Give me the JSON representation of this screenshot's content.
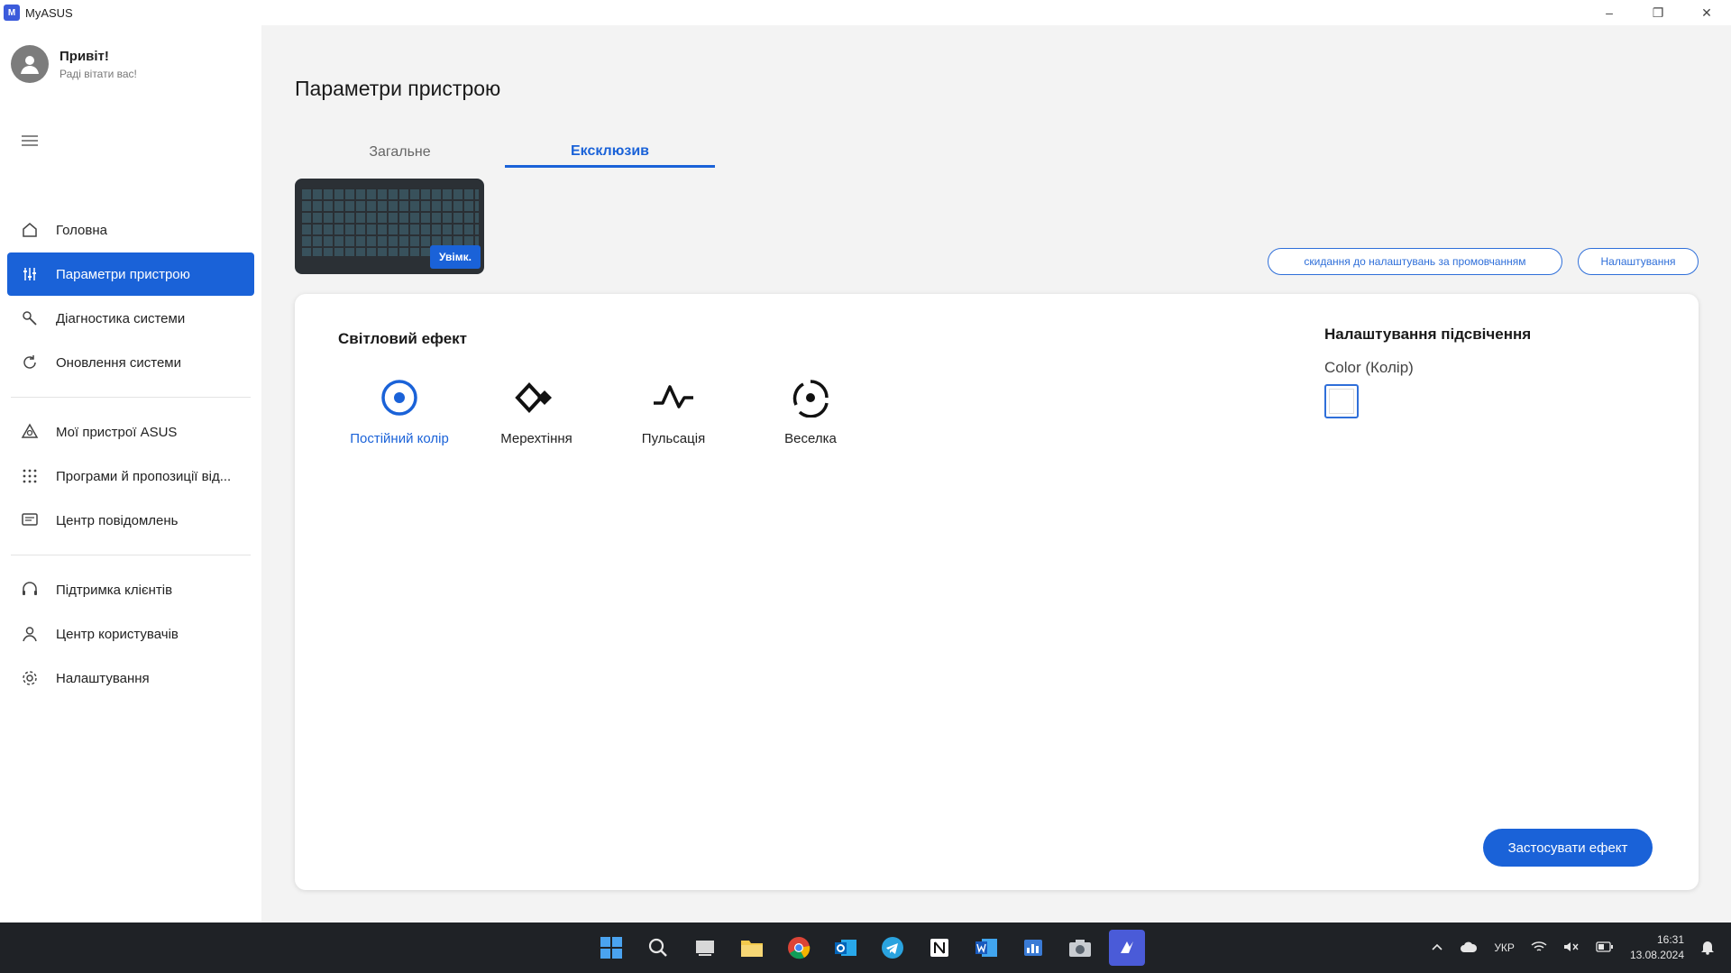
{
  "window": {
    "title": "MyASUS",
    "logo_text": "M",
    "controls": {
      "minimize": "–",
      "restore": "❐",
      "close": "✕"
    }
  },
  "user": {
    "greeting": "Привіт!",
    "subtitle": "Раді вітати вас!"
  },
  "sidebar": {
    "items": [
      {
        "label": "Головна",
        "icon": "home-icon"
      },
      {
        "label": "Параметри пристрою",
        "icon": "sliders-icon",
        "active": true
      },
      {
        "label": "Діагностика системи",
        "icon": "wrench-icon"
      },
      {
        "label": "Оновлення системи",
        "icon": "update-icon"
      },
      {
        "label": "Мої пристрої ASUS",
        "icon": "devices-icon"
      },
      {
        "label": "Програми й пропозиції від...",
        "icon": "apps-grid-icon"
      },
      {
        "label": "Центр повідомлень",
        "icon": "message-icon"
      },
      {
        "label": "Підтримка клієнтів",
        "icon": "headset-icon"
      },
      {
        "label": "Центр користувачів",
        "icon": "user-icon"
      },
      {
        "label": "Налаштування",
        "icon": "gear-icon"
      }
    ]
  },
  "main": {
    "title": "Параметри пристрою",
    "tabs": [
      {
        "label": "Загальне"
      },
      {
        "label": "Ексклюзив",
        "active": true
      }
    ],
    "keyboard_badge": "Увімк.",
    "reset_button": "скидання до налаштувань за промовчанням",
    "settings_button": "Налаштування",
    "effects": {
      "title": "Світловий ефект",
      "items": [
        {
          "label": "Постійний колір",
          "icon": "static-color-icon",
          "selected": true
        },
        {
          "label": "Мерехтіння",
          "icon": "blink-icon"
        },
        {
          "label": "Пульсація",
          "icon": "pulse-icon"
        },
        {
          "label": "Веселка",
          "icon": "rainbow-icon"
        }
      ]
    },
    "backlight": {
      "title": "Налаштування підсвічення",
      "color_label": "Color (Колір)",
      "color_value": "#ffffff"
    },
    "apply_button": "Застосувати ефект"
  },
  "taskbar": {
    "language": "УКР",
    "time": "16:31",
    "date": "13.08.2024"
  },
  "colors": {
    "accent": "#1a62d8",
    "taskbar": "#1f2226"
  }
}
